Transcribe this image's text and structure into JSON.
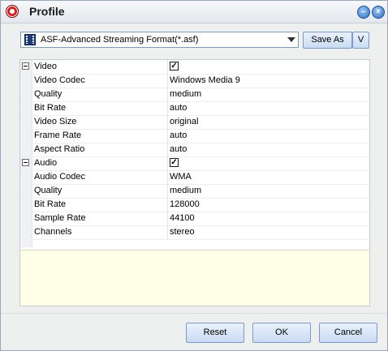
{
  "window": {
    "title": "Profile"
  },
  "icons": {
    "app": "app-logo-icon",
    "minimize": "minimize-icon",
    "close": "close-icon"
  },
  "format": {
    "selected": "ASF-Advanced Streaming Format(*.asf)"
  },
  "toolbar": {
    "save_as_label": "Save As",
    "v_label": "V"
  },
  "properties": {
    "video": {
      "label": "Video",
      "enabled": true,
      "rows": [
        {
          "name": "Video Codec",
          "value": "Windows Media 9"
        },
        {
          "name": "Quality",
          "value": "medium"
        },
        {
          "name": "Bit Rate",
          "value": "auto"
        },
        {
          "name": "Video Size",
          "value": "original"
        },
        {
          "name": "Frame Rate",
          "value": "auto"
        },
        {
          "name": "Aspect Ratio",
          "value": "auto"
        }
      ]
    },
    "audio": {
      "label": "Audio",
      "enabled": true,
      "rows": [
        {
          "name": "Audio Codec",
          "value": "WMA"
        },
        {
          "name": "Quality",
          "value": "medium"
        },
        {
          "name": "Bit Rate",
          "value": "128000"
        },
        {
          "name": "Sample Rate",
          "value": "44100"
        },
        {
          "name": "Channels",
          "value": "stereo"
        }
      ]
    },
    "check_mark": "✓"
  },
  "footer": {
    "reset_label": "Reset",
    "ok_label": "OK",
    "cancel_label": "Cancel"
  },
  "colors": {
    "description_bg": "#fffee6",
    "button_bg": "#c9dbf3"
  }
}
